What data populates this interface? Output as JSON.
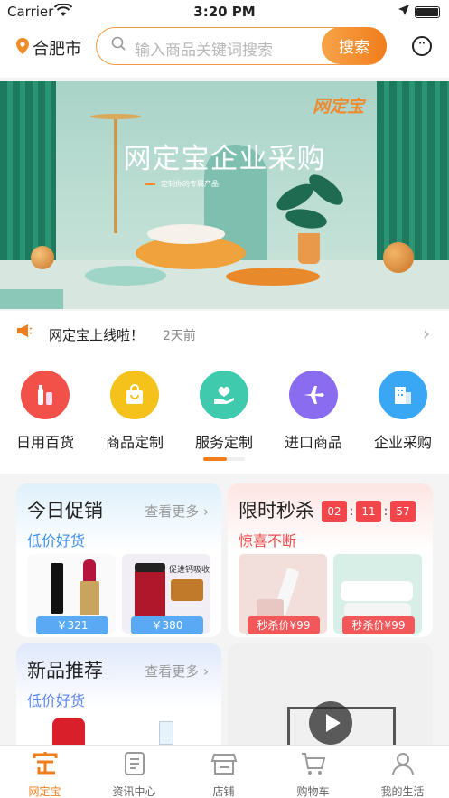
{
  "status_bar": {
    "carrier": "Carrier",
    "time": "3:20 PM"
  },
  "header": {
    "city": "合肥市",
    "search_placeholder": "输入商品关键词搜索",
    "search_button": "搜索",
    "message_icon": "chat-bubble-icon"
  },
  "banner": {
    "brand": "网定宝",
    "title": "网定宝企业采购",
    "subtitle": "定制你的专属产品"
  },
  "notice": {
    "text": "网定宝上线啦！",
    "time": "2天前"
  },
  "categories": [
    {
      "label": "日用百货",
      "icon": "daily-goods-icon",
      "color": "#f2514a"
    },
    {
      "label": "商品定制",
      "icon": "shopping-bag-icon",
      "color": "#f4c21a"
    },
    {
      "label": "服务定制",
      "icon": "heart-hand-icon",
      "color": "#3fc9ad"
    },
    {
      "label": "进口商品",
      "icon": "airplane-icon",
      "color": "#8a6cf0"
    },
    {
      "label": "企业采购",
      "icon": "building-icon",
      "color": "#3aa7f4"
    }
  ],
  "promo_today": {
    "title": "今日促销",
    "more": "查看更多",
    "subtitle": "低价好货",
    "prices": [
      "￥321",
      "￥380"
    ]
  },
  "flash_sale": {
    "title": "限时秒杀",
    "timer": [
      "02",
      "11",
      "57"
    ],
    "subtitle": "惊喜不断",
    "prices": [
      "秒杀价¥99",
      "秒杀价¥99"
    ]
  },
  "new_products": {
    "title": "新品推荐",
    "more": "查看更多",
    "subtitle": "低价好货"
  },
  "product_labels": {
    "calcium_tag": "促进钙吸收"
  },
  "tabbar": [
    {
      "label": "网定宝",
      "icon": "home-logo-icon",
      "active": true
    },
    {
      "label": "资讯中心",
      "icon": "news-icon",
      "active": false
    },
    {
      "label": "店铺",
      "icon": "store-icon",
      "active": false
    },
    {
      "label": "购物车",
      "icon": "cart-icon",
      "active": false
    },
    {
      "label": "我的生活",
      "icon": "profile-icon",
      "active": false
    }
  ]
}
